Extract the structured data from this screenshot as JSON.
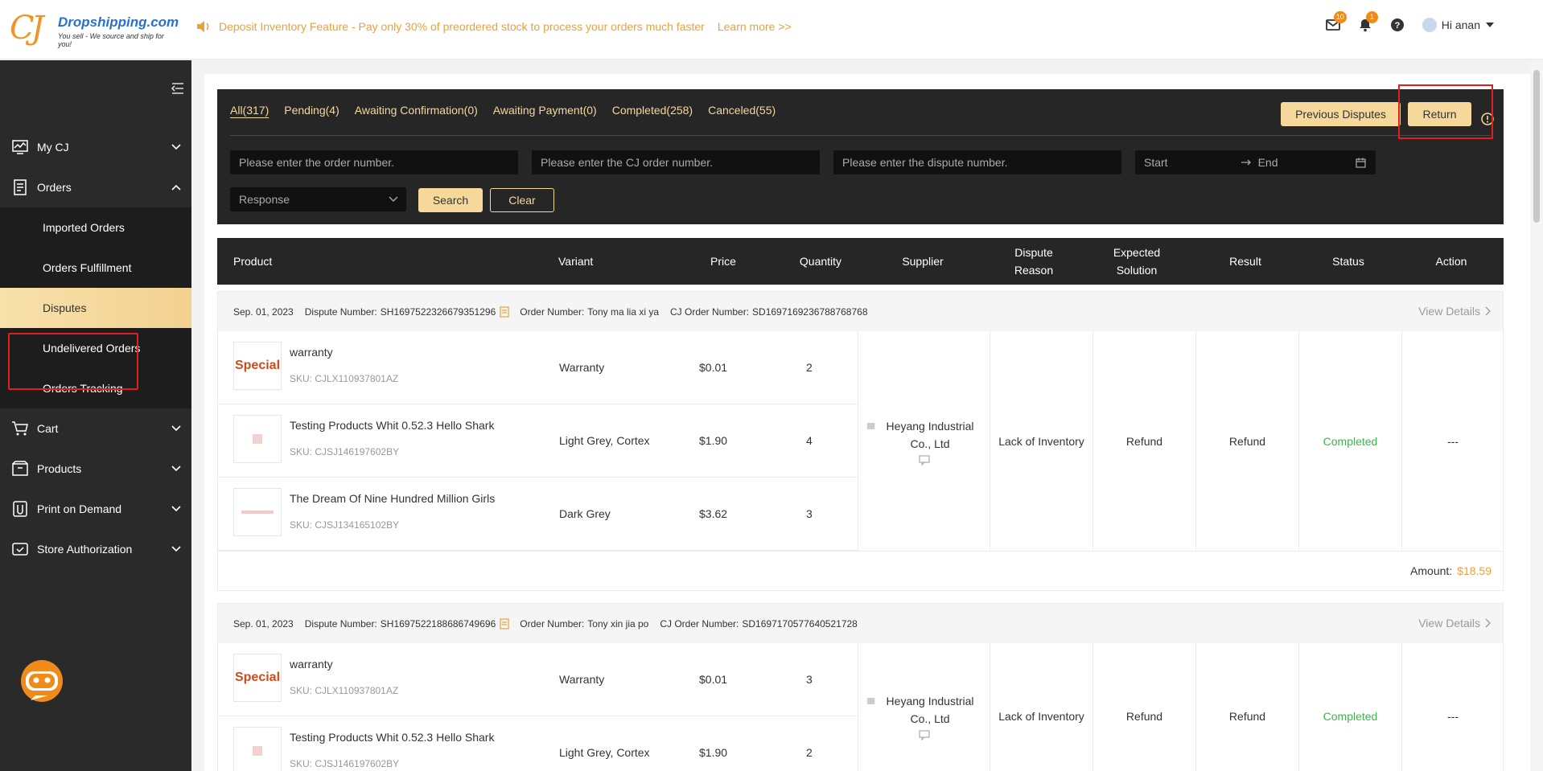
{
  "header": {
    "logo_brand": "Dropshipping.com",
    "logo_slogan": "You sell - We source and ship for you!",
    "notice_text": "Deposit Inventory Feature - Pay only 30% of preordered stock to process your orders much faster",
    "learn_more": "Learn more >>",
    "mail_badge": "10",
    "bell_badge": "1",
    "user_greeting": "Hi anan"
  },
  "sidebar": {
    "my_cj": "My CJ",
    "orders": "Orders",
    "orders_sub": [
      "Imported Orders",
      "Orders Fulfillment",
      "Disputes",
      "Undelivered Orders",
      "Orders Tracking"
    ],
    "cart": "Cart",
    "products": "Products",
    "pod": "Print on Demand",
    "store_auth": "Store Authorization"
  },
  "filter": {
    "tabs": [
      "All(317)",
      "Pending(4)",
      "Awaiting Confirmation(0)",
      "Awaiting Payment(0)",
      "Completed(258)",
      "Canceled(55)"
    ],
    "previous_disputes": "Previous Disputes",
    "return": "Return",
    "order_number_placeholder": "Please enter the order number.",
    "cj_order_placeholder": "Please enter the CJ order number.",
    "dispute_placeholder": "Please enter the dispute number.",
    "date_start": "Start",
    "date_end": "End",
    "response_select": "Response",
    "search": "Search",
    "clear": "Clear"
  },
  "table": {
    "headers": [
      "Product",
      "Variant",
      "Price",
      "Quantity",
      "Supplier",
      "Dispute Reason",
      "Expected Solution",
      "Result",
      "Status",
      "Action"
    ]
  },
  "orders": [
    {
      "date": "Sep. 01, 2023",
      "dispute_label": "Dispute Number:",
      "dispute_number": "SH1697522326679351296",
      "order_label": "Order Number:",
      "order_number": "Tony ma lia xi ya",
      "cj_label": "CJ Order Number:",
      "cj_order_number": "SD1697169236788768768",
      "view_details": "View Details",
      "items": [
        {
          "name": "warranty",
          "sku": "SKU: CJLX110937801AZ",
          "variant": "Warranty",
          "price": "$0.01",
          "qty": "2",
          "thumb": "Special"
        },
        {
          "name": "Testing Products Whit 0.52.3 Hello Shark",
          "sku": "SKU: CJSJ146197602BY",
          "variant": "Light Grey, Cortex",
          "price": "$1.90",
          "qty": "4",
          "thumb": ""
        },
        {
          "name": "The Dream Of Nine Hundred Million Girls",
          "sku": "SKU: CJSJ134165102BY",
          "variant": "Dark Grey",
          "price": "$3.62",
          "qty": "3",
          "thumb": ""
        }
      ],
      "supplier": "Heyang Industrial Co., Ltd",
      "reason": "Lack of Inventory",
      "solution": "Refund",
      "result": "Refund",
      "status": "Completed",
      "action": "---",
      "amount_label": "Amount:",
      "amount": "$18.59"
    },
    {
      "date": "Sep. 01, 2023",
      "dispute_label": "Dispute Number:",
      "dispute_number": "SH1697522188686749696",
      "order_label": "Order Number:",
      "order_number": "Tony xin jia po",
      "cj_label": "CJ Order Number:",
      "cj_order_number": "SD1697170577640521728",
      "view_details": "View Details",
      "items": [
        {
          "name": "warranty",
          "sku": "SKU: CJLX110937801AZ",
          "variant": "Warranty",
          "price": "$0.01",
          "qty": "3",
          "thumb": "Special"
        },
        {
          "name": "Testing Products Whit 0.52.3 Hello Shark",
          "sku": "SKU: CJSJ146197602BY",
          "variant": "Light Grey, Cortex",
          "price": "$1.90",
          "qty": "2",
          "thumb": ""
        }
      ],
      "supplier": "Heyang Industrial Co., Ltd",
      "reason": "Lack of Inventory",
      "solution": "Refund",
      "result": "Refund",
      "status": "Completed",
      "action": "---"
    }
  ]
}
